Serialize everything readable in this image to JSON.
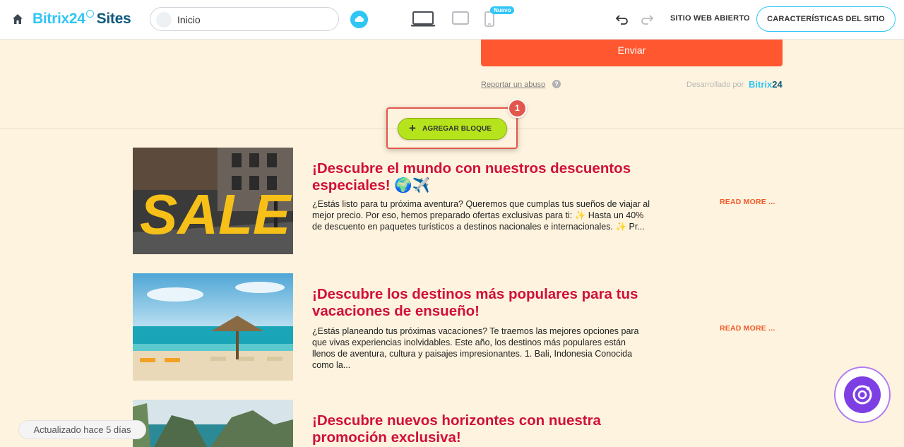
{
  "topbar": {
    "logo_brand": "Bitrix24",
    "logo_product": "Sites",
    "page_selector_value": "Inicio",
    "new_badge": "Nuevo",
    "open_site_label": "SITIO WEB ABIERTO",
    "features_label": "CARACTERÍSTICAS DEL SITIO"
  },
  "form": {
    "submit_label": "Enviar",
    "report_label": "Reportar un abuso",
    "help_glyph": "?",
    "powered_label": "Desarrollado por",
    "powered_brand": "Bitrix",
    "powered_brand_num": "24"
  },
  "add_block": {
    "label": "AGREGAR BLOQUE",
    "plus": "+",
    "step_badge": "1"
  },
  "posts": [
    {
      "title": "¡Descubre el mundo con nuestros descuentos especiales! 🌍✈️",
      "excerpt": "¿Estás listo para tu próxima aventura? Queremos que cumplas tus sueños de viajar al mejor precio. Por eso, hemos preparado ofertas exclusivas para ti: ✨ Hasta un 40% de descuento en paquetes turísticos a destinos nacionales e internacionales. ✨ Pr...",
      "read_more": "READ MORE ...",
      "image_text": "SALE"
    },
    {
      "title": "¡Descubre los destinos más populares para tus vacaciones de ensueño!",
      "excerpt": "¿Estás planeando tus próximas vacaciones? Te traemos las mejores opciones para que vivas experiencias inolvidables. Este año, los destinos más populares están llenos de aventura, cultura y paisajes impresionantes. 1. Bali, Indonesia Conocida como la...",
      "read_more": "READ MORE ..."
    },
    {
      "title": "¡Descubre nuevos horizontes con nuestra promoción exclusiva!"
    }
  ],
  "status": {
    "updated": "Actualizado hace 5 días"
  },
  "colors": {
    "page_bg": "#fef3de",
    "brand_blue": "#2fc6f6",
    "brand_dark": "#0f5a7c",
    "submit_orange": "#ff5830",
    "add_block_green": "#b6e41c",
    "highlight_red": "#e2574c",
    "post_title": "#d0103a",
    "read_more": "#f05a2a",
    "assistant_purple": "#7d3fe4"
  },
  "icons": {
    "home": "home-icon",
    "cloud": "cloud-icon",
    "desktop": "desktop-icon",
    "tablet": "tablet-icon",
    "mobile": "mobile-icon",
    "undo": "undo-icon",
    "redo": "redo-icon",
    "assistant": "copilot-icon"
  }
}
